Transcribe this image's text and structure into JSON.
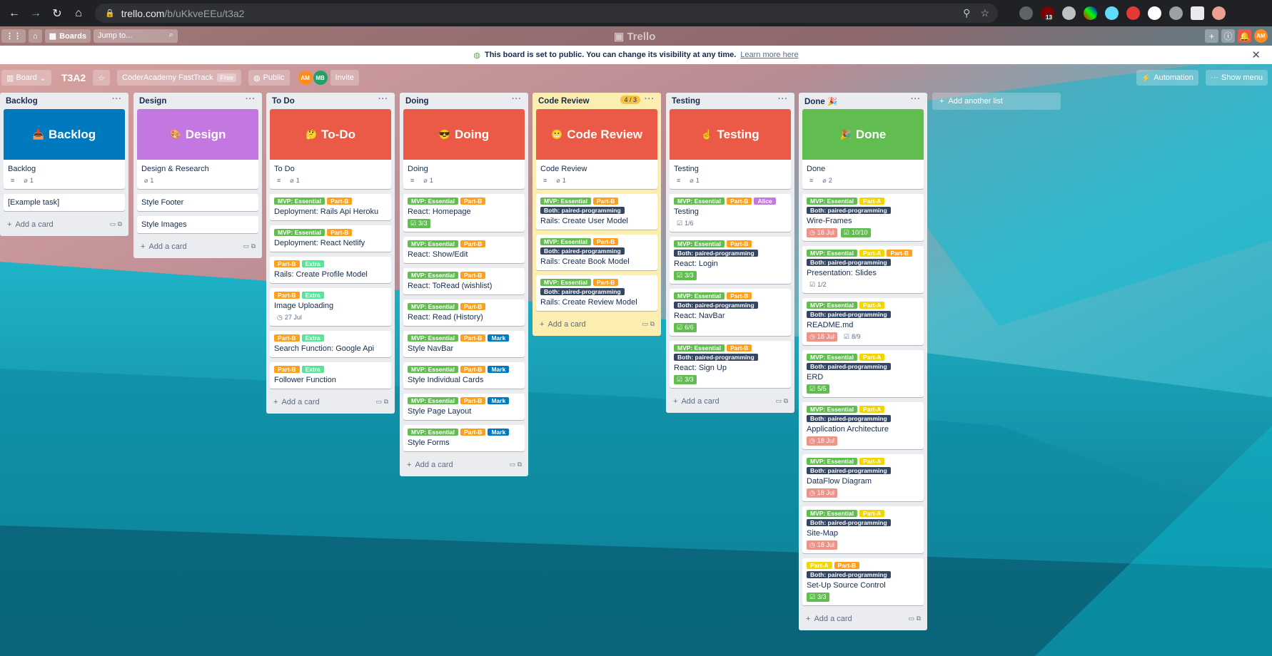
{
  "browser": {
    "url_domain": "trello.com",
    "url_path": "/b/uKkveEEu/t3a2",
    "extension_badge": "13"
  },
  "topbar": {
    "boards_label": "Boards",
    "jump_placeholder": "Jump to...",
    "logo": "Trello",
    "avatar": "AM"
  },
  "notice": {
    "text": "This board is set to public. You can change its visibility at any time.",
    "link": "Learn more here"
  },
  "board": {
    "view_label": "Board",
    "title": "T3A2",
    "workspace": "CoderAcademy FastTrack",
    "workspace_badge": "Free",
    "visibility": "Public",
    "members": [
      "AM",
      "MB"
    ],
    "invite": "Invite",
    "automation": "Automation",
    "show_menu": "Show menu",
    "add_list": "Add another list"
  },
  "label_colors": {
    "MVP: Essential": "#61bd4f",
    "Part-B": "#ff9f1a",
    "Part-A": "#f2d600",
    "Extra": "#51e898",
    "Mark": "#0079bf",
    "Alice": "#c377e0",
    "Both: paired-programming": "#344563"
  },
  "lists": [
    {
      "name": "Backlog",
      "add_card": "Add a card",
      "cards": [
        {
          "cover": "Backlog",
          "cover_icon": "📥",
          "cover_color": "#0079bf",
          "title": "Backlog",
          "badges": {
            "desc": true,
            "attach": "1"
          }
        },
        {
          "title": "[Example task]"
        }
      ]
    },
    {
      "name": "Design",
      "add_card": "Add a card",
      "cards": [
        {
          "cover": "Design",
          "cover_icon": "🎨",
          "cover_color": "#c377e0",
          "title": "Design & Research",
          "badges": {
            "attach": "1"
          }
        },
        {
          "title": "Style Footer"
        },
        {
          "title": "Style Images"
        }
      ]
    },
    {
      "name": "To Do",
      "add_card": "Add a card",
      "cards": [
        {
          "cover": "To-Do",
          "cover_icon": "🤔",
          "cover_color": "#eb5a46",
          "title": "To Do",
          "badges": {
            "desc": true,
            "attach": "1"
          }
        },
        {
          "labels": [
            "MVP: Essential",
            "Part-B"
          ],
          "title": "Deployment: Rails Api Heroku"
        },
        {
          "labels": [
            "MVP: Essential",
            "Part-B"
          ],
          "title": "Deployment: React Netlify"
        },
        {
          "labels": [
            "Part-B",
            "Extra"
          ],
          "title": "Rails: Create Profile Model"
        },
        {
          "labels": [
            "Part-B",
            "Extra"
          ],
          "title": "Image Uploading",
          "badges": {
            "date": "27 Jul"
          }
        },
        {
          "labels": [
            "Part-B",
            "Extra"
          ],
          "title": "Search Function: Google Api"
        },
        {
          "labels": [
            "Part-B",
            "Extra"
          ],
          "title": "Follower Function"
        }
      ]
    },
    {
      "name": "Doing",
      "add_card": "Add a card",
      "cards": [
        {
          "cover": "Doing",
          "cover_icon": "😎",
          "cover_color": "#eb5a46",
          "title": "Doing",
          "badges": {
            "desc": true,
            "attach": "1"
          }
        },
        {
          "labels": [
            "MVP: Essential",
            "Part-B"
          ],
          "title": "React: Homepage",
          "badges": {
            "checklist": "3/3",
            "checklist_done": true
          }
        },
        {
          "labels": [
            "MVP: Essential",
            "Part-B"
          ],
          "title": "React: Show/Edit"
        },
        {
          "labels": [
            "MVP: Essential",
            "Part-B"
          ],
          "title": "React: ToRead (wishlist)"
        },
        {
          "labels": [
            "MVP: Essential",
            "Part-B"
          ],
          "title": "React: Read (History)"
        },
        {
          "labels": [
            "MVP: Essential",
            "Part-B",
            "Mark"
          ],
          "title": "Style NavBar"
        },
        {
          "labels": [
            "MVP: Essential",
            "Part-B",
            "Mark"
          ],
          "title": "Style Individual Cards"
        },
        {
          "labels": [
            "MVP: Essential",
            "Part-B",
            "Mark"
          ],
          "title": "Style Page Layout"
        },
        {
          "labels": [
            "MVP: Essential",
            "Part-B",
            "Mark"
          ],
          "title": "Style Forms"
        }
      ]
    },
    {
      "name": "Code Review",
      "wip": "4 / 3",
      "yellow": true,
      "add_card": "Add a card",
      "cards": [
        {
          "cover": "Code Review",
          "cover_icon": "😬",
          "cover_color": "#eb5a46",
          "title": "Code Review",
          "badges": {
            "desc": true,
            "attach": "1"
          }
        },
        {
          "labels": [
            "MVP: Essential",
            "Part-B",
            "Both: paired-programming"
          ],
          "title": "Rails: Create User Model"
        },
        {
          "labels": [
            "MVP: Essential",
            "Part-B",
            "Both: paired-programming"
          ],
          "title": "Rails: Create Book Model"
        },
        {
          "labels": [
            "MVP: Essential",
            "Part-B",
            "Both: paired-programming"
          ],
          "title": "Rails: Create Review Model"
        }
      ]
    },
    {
      "name": "Testing",
      "add_card": "Add a card",
      "cards": [
        {
          "cover": "Testing",
          "cover_icon": "☝",
          "cover_color": "#eb5a46",
          "title": "Testing",
          "badges": {
            "desc": true,
            "attach": "1"
          }
        },
        {
          "labels": [
            "MVP: Essential",
            "Part-B",
            "Alice"
          ],
          "title": "Testing",
          "badges": {
            "checklist": "1/6"
          }
        },
        {
          "labels": [
            "MVP: Essential",
            "Part-B",
            "Both: paired-programming"
          ],
          "title": "React: Login",
          "badges": {
            "checklist": "3/3",
            "checklist_done": true
          }
        },
        {
          "labels": [
            "MVP: Essential",
            "Part-B",
            "Both: paired-programming"
          ],
          "title": "React: NavBar",
          "badges": {
            "checklist": "6/6",
            "checklist_done": true
          }
        },
        {
          "labels": [
            "MVP: Essential",
            "Part-B",
            "Both: paired-programming"
          ],
          "title": "React: Sign Up",
          "badges": {
            "checklist": "3/3",
            "checklist_done": true
          }
        }
      ]
    },
    {
      "name": "Done 🎉",
      "add_card": "Add a card",
      "cards": [
        {
          "cover": "Done",
          "cover_icon": "🎉",
          "cover_color": "#61bd4f",
          "title": "Done",
          "badges": {
            "desc": true,
            "attach": "2"
          }
        },
        {
          "labels": [
            "MVP: Essential",
            "Part-A",
            "Both: paired-programming"
          ],
          "title": "Wire-Frames",
          "badges": {
            "date": "18 Jul",
            "date_late": true,
            "checklist": "10/10",
            "checklist_done": true
          }
        },
        {
          "labels": [
            "MVP: Essential",
            "Part-A",
            "Part-B",
            "Both: paired-programming"
          ],
          "title": "Presentation: Slides",
          "badges": {
            "checklist": "1/2"
          }
        },
        {
          "labels": [
            "MVP: Essential",
            "Part-A",
            "Both: paired-programming"
          ],
          "title": "README.md",
          "badges": {
            "date": "18 Jul",
            "date_late": true,
            "checklist": "8/9"
          }
        },
        {
          "labels": [
            "MVP: Essential",
            "Part-A",
            "Both: paired-programming"
          ],
          "title": "ERD",
          "badges": {
            "checklist": "5/5",
            "checklist_done": true
          }
        },
        {
          "labels": [
            "MVP: Essential",
            "Part-A",
            "Both: paired-programming"
          ],
          "title": "Application Architecture",
          "badges": {
            "date": "18 Jul",
            "date_late": true
          }
        },
        {
          "labels": [
            "MVP: Essential",
            "Part-A",
            "Both: paired-programming"
          ],
          "title": "DataFlow Diagram",
          "badges": {
            "date": "18 Jul",
            "date_late": true
          }
        },
        {
          "labels": [
            "MVP: Essential",
            "Part-A",
            "Both: paired-programming"
          ],
          "title": "Site-Map",
          "badges": {
            "date": "18 Jul",
            "date_late": true
          }
        },
        {
          "labels": [
            "Part-A",
            "Part-B",
            "Both: paired-programming"
          ],
          "title": "Set-Up Source Control",
          "badges": {
            "checklist": "3/3",
            "checklist_done": true
          }
        }
      ]
    }
  ]
}
